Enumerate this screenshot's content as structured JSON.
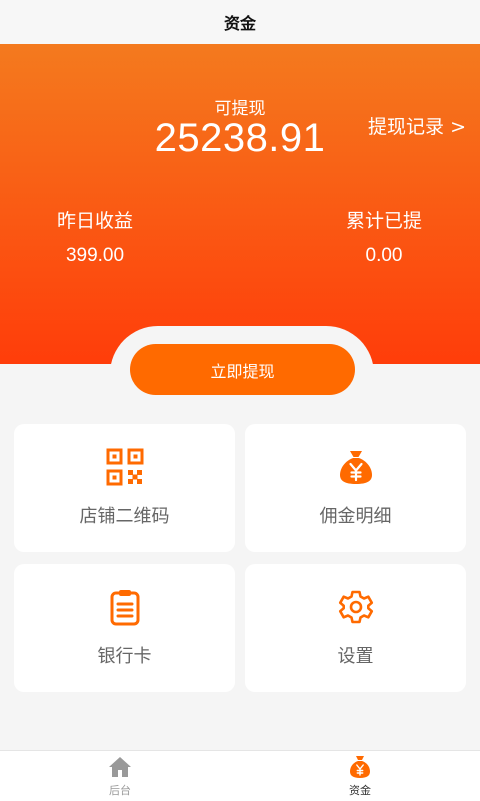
{
  "header": {
    "title": "资金"
  },
  "balance": {
    "available_label": "可提现",
    "available_amount": "25238.91",
    "record_link": "提现记录 >"
  },
  "stats": {
    "yesterday_label": "昨日收益",
    "yesterday_value": "399.00",
    "total_label": "累计已提",
    "total_value": "0.00"
  },
  "actions": {
    "withdraw_label": "立即提现"
  },
  "grid": [
    {
      "label": "店铺二维码",
      "icon": "qr-code-icon"
    },
    {
      "label": "佣金明细",
      "icon": "money-bag-icon"
    },
    {
      "label": "银行卡",
      "icon": "clipboard-icon"
    },
    {
      "label": "设置",
      "icon": "gear-icon"
    }
  ],
  "tabbar": {
    "items": [
      {
        "label": "后台",
        "icon": "home-icon",
        "active": false
      },
      {
        "label": "资金",
        "icon": "money-bag-icon",
        "active": true
      }
    ]
  },
  "colors": {
    "accent": "#ff6a00",
    "gradient_top": "#f47a1e",
    "gradient_bottom": "#ff3d0a",
    "inactive_tab": "#999999"
  }
}
